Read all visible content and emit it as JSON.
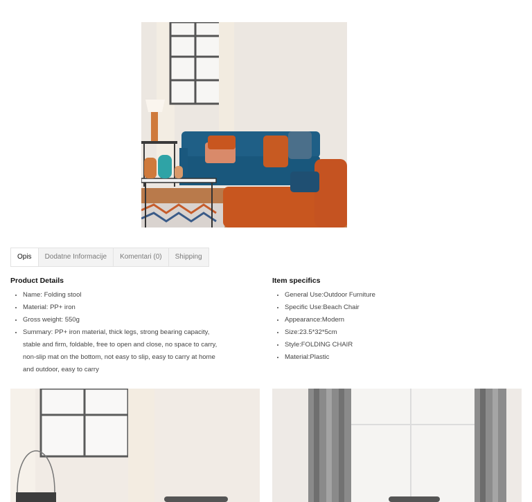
{
  "tabs": [
    {
      "label": "Opis",
      "active": true
    },
    {
      "label": "Dodatne Informacije",
      "active": false
    },
    {
      "label": "Komentari (0)",
      "active": false
    },
    {
      "label": "Shipping",
      "active": false
    }
  ],
  "product_details": {
    "title": "Product Details",
    "items": [
      "Name: Folding stool",
      "Material: PP+ iron",
      "Gross weight: 550g",
      "Summary: PP+ iron material, thick legs, strong bearing capacity, stable and firm, foldable, free to open and close, no space to carry, non-slip mat on the bottom, not easy to slip, easy to carry at home and outdoor, easy to carry"
    ]
  },
  "item_specifics": {
    "title": "Item specifics",
    "items": [
      "General Use:Outdoor Furniture",
      "Specific Use:Beach Chair",
      "Appearance:Modern",
      "Size:23.5*32*5cm",
      "Style:FOLDING CHAIR",
      "Material:Plastic"
    ]
  },
  "colors": {
    "sofa_blue": "#1f5f86",
    "orange": "#c8561f",
    "wall": "#ece6df"
  }
}
